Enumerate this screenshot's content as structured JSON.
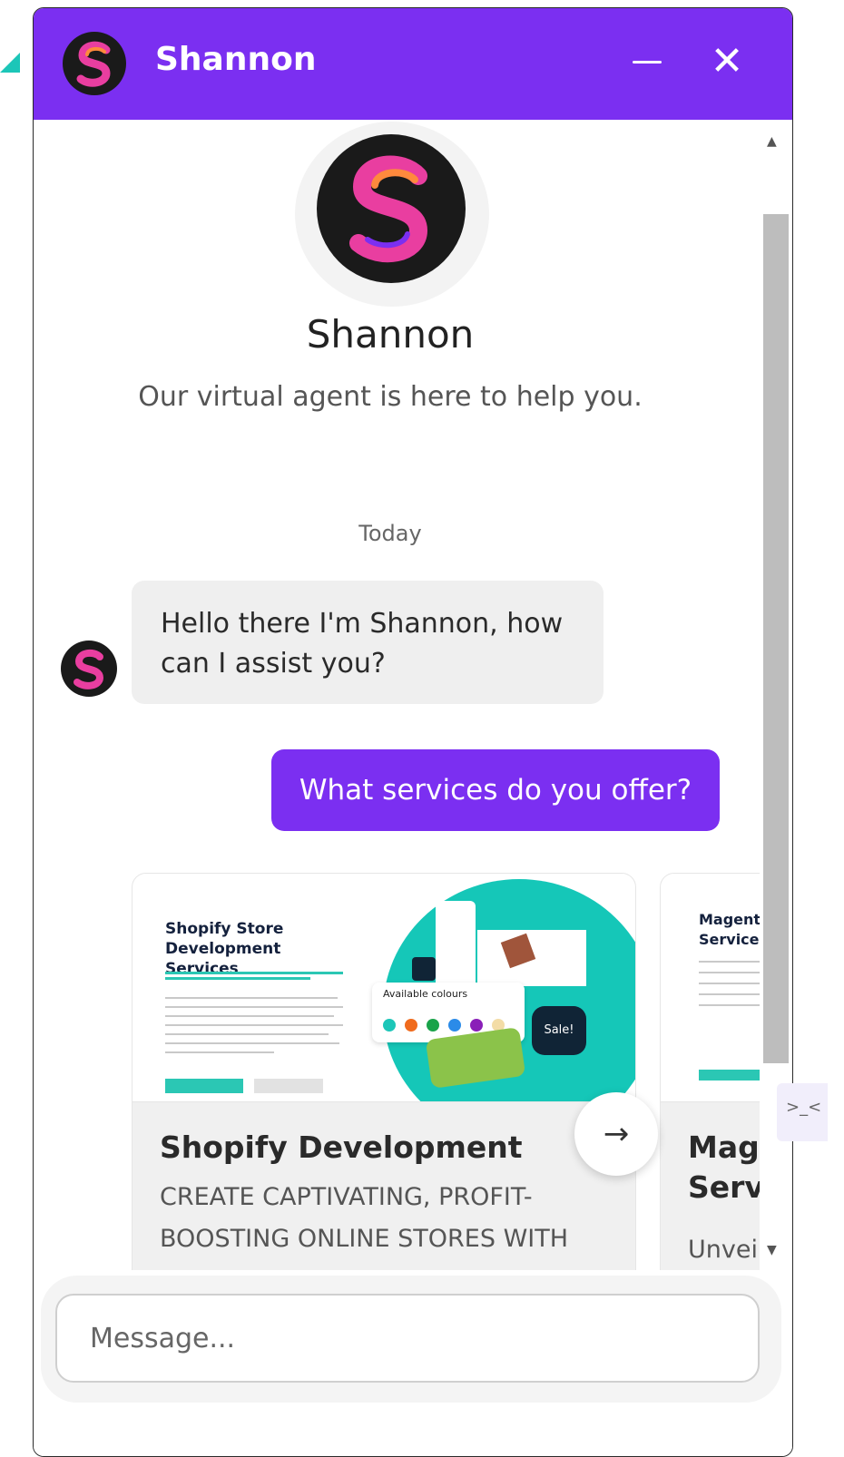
{
  "colors": {
    "brand": "#7b2ff1",
    "accent": "#1cc6b8"
  },
  "header": {
    "title": "Shannon",
    "minimize_icon": "minimize-icon",
    "close_icon": "close-icon",
    "close_glyph": "✕"
  },
  "profile": {
    "name": "Shannon",
    "tagline": "Our virtual agent is here to help you."
  },
  "conversation": {
    "date_label": "Today",
    "messages": [
      {
        "sender": "bot",
        "text": "Hello there I'm Shannon, how can I assist you?"
      },
      {
        "sender": "user",
        "text": "What services do you offer?"
      }
    ]
  },
  "carousel": {
    "next_glyph": "→",
    "cards": [
      {
        "title": "Shopify Development",
        "description": "CREATE CAPTIVATING, PROFIT-BOOSTING ONLINE STORES WITH OUR SUPERCHARGED SHOPIFY",
        "thumb_heading": "Shopify Store Development Services",
        "thumb_colours_label": "Available colours",
        "thumb_sale": "Sale!"
      },
      {
        "title": "Mage Servi",
        "description": "Unveil",
        "thumb_heading": "Magento Services"
      }
    ]
  },
  "composer": {
    "placeholder": "Message..."
  },
  "scroll": {
    "up_glyph": "▲",
    "down_glyph": "▼"
  },
  "side_tab": {
    "text": ">_<"
  }
}
